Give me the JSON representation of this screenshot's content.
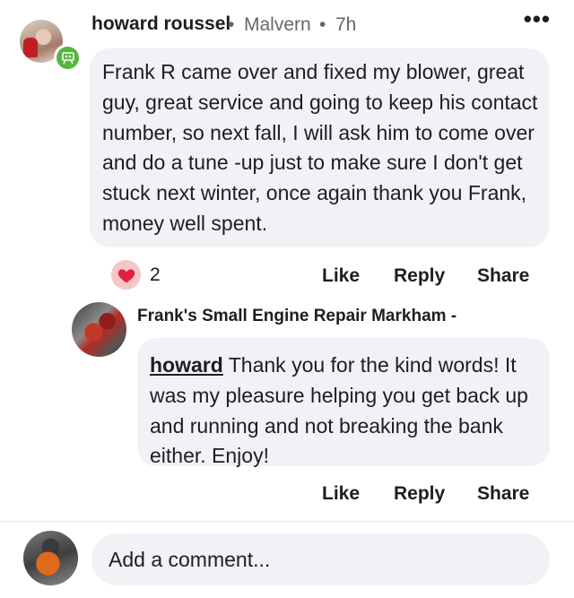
{
  "comment": {
    "author": "howard roussel",
    "location": "Malvern",
    "time": "7h",
    "separator": "•",
    "more_label": "•••",
    "text": "Frank R came over and fixed my blower, great guy, great service and going to keep his contact number, so next fall, I will ask him to come over and do a tune -up just to make sure I don't get stuck next winter, once again thank you Frank, money well spent.",
    "reaction_count": "2",
    "reaction_icon": "heart-icon",
    "badge_icon": "top-fan-icon"
  },
  "actions": {
    "like": "Like",
    "reply": "Reply",
    "share": "Share"
  },
  "reply": {
    "author": "Frank's Small Engine Repair Markham -",
    "mention": "howard",
    "text": " Thank you for the kind words! It was my pleasure helping you get back up and running and not breaking the bank either. Enjoy!"
  },
  "composer": {
    "placeholder": "Add a comment..."
  },
  "colors": {
    "bubble": "#f0f2f5",
    "heart": "#e41e3f",
    "badge": "#56b43f",
    "muted": "#65676b"
  }
}
